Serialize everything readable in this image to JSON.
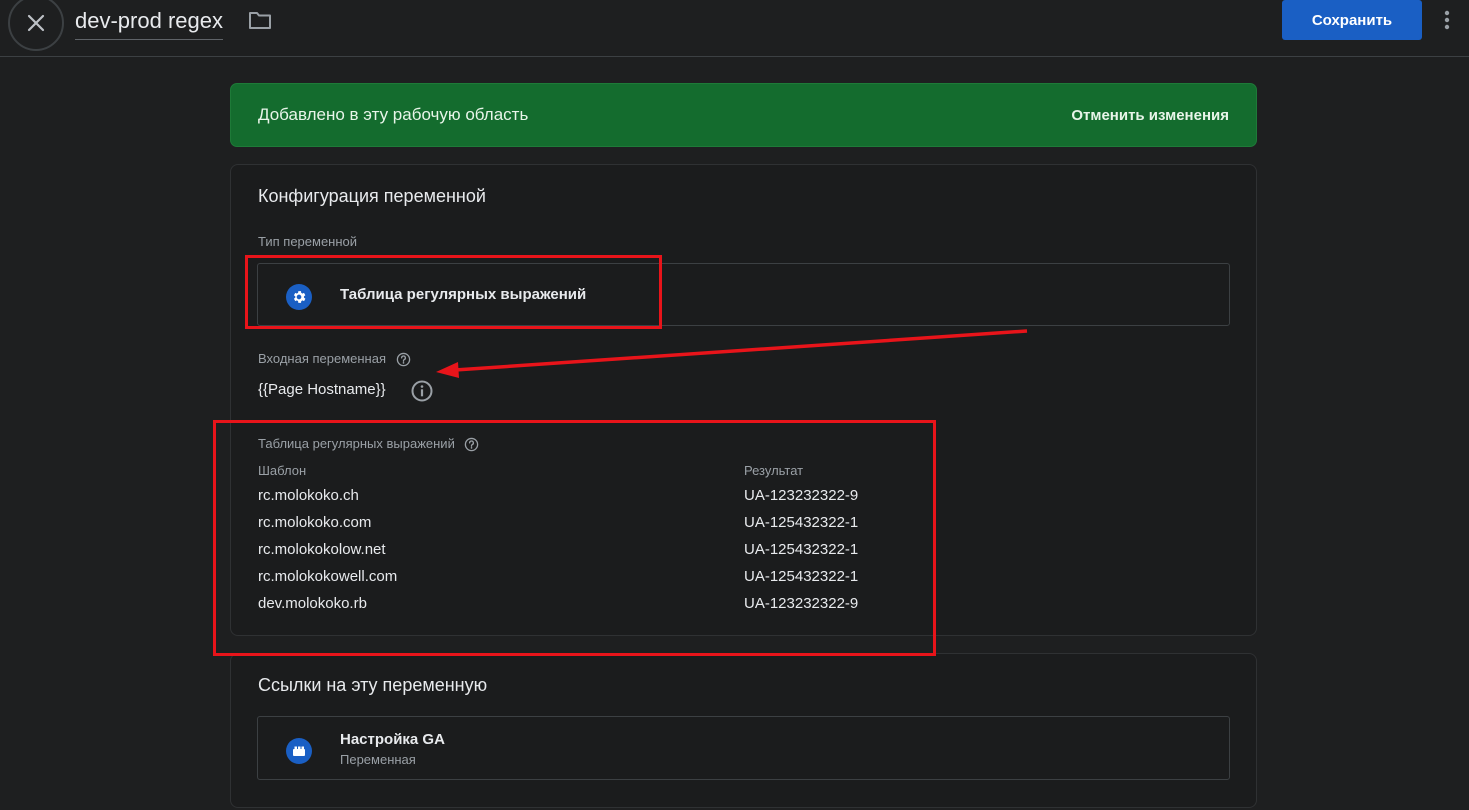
{
  "header": {
    "title": "dev-prod regex",
    "save_label": "Сохранить"
  },
  "banner": {
    "text": "Добавлено в эту рабочую область",
    "action": "Отменить изменения"
  },
  "config": {
    "title": "Конфигурация переменной",
    "type_label": "Тип переменной",
    "type_value": "Таблица регулярных выражений",
    "input_label": "Входная переменная",
    "input_value": "{{Page Hostname}}",
    "table_label": "Таблица регулярных выражений",
    "col_pattern": "Шаблон",
    "col_result": "Результат",
    "rows": [
      {
        "pattern": "rc.molokoko.ch",
        "result": "UA-123232322-9"
      },
      {
        "pattern": "rc.molokoko.com",
        "result": "UA-125432322-1"
      },
      {
        "pattern": "rc.molokokolow.net",
        "result": "UA-125432322-1"
      },
      {
        "pattern": "rc.molokokowell.com",
        "result": "UA-125432322-1"
      },
      {
        "pattern": "dev.molokoko.rb",
        "result": "UA-123232322-9"
      }
    ]
  },
  "references": {
    "title": "Ссылки на эту переменную",
    "item_title": "Настройка GA",
    "item_subtitle": "Переменная"
  },
  "icons": {
    "close": "close-icon",
    "folder": "folder-icon",
    "more": "more-vert-icon",
    "gear": "gear-icon",
    "help": "help-icon",
    "info": "info-icon",
    "ga_settings": "ga-settings-icon"
  },
  "colors": {
    "primary": "#1a5fc4",
    "banner": "#146c2e",
    "annotation": "#e8141a"
  }
}
